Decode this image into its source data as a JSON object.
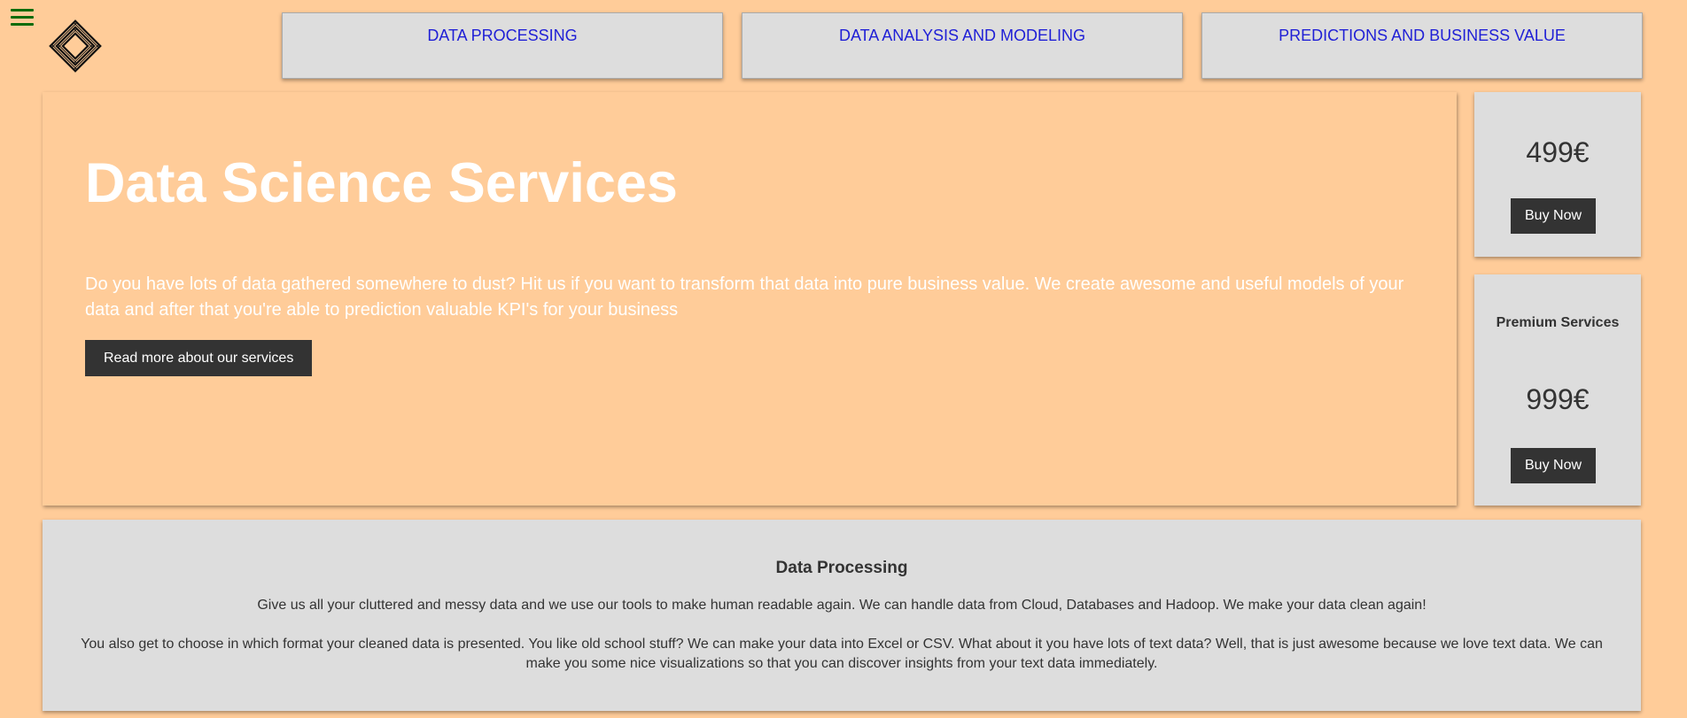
{
  "nav": {
    "tabs": [
      {
        "label": "DATA PROCESSING"
      },
      {
        "label": "DATA ANALYSIS AND MODELING"
      },
      {
        "label": "PREDICTIONS AND BUSINESS VALUE"
      }
    ]
  },
  "hero": {
    "title": "Data Science Services",
    "description": "Do you have lots of data gathered somewhere to dust? Hit us if you want to transform that data into pure business value. We create awesome and useful models of your data and after that you're able to prediction valuable KPI's for your business",
    "button_label": "Read more about our services"
  },
  "pricing": [
    {
      "label": "",
      "price": "499€",
      "button_label": "Buy Now"
    },
    {
      "label": "Premium Services",
      "price": "999€",
      "button_label": "Buy Now"
    }
  ],
  "info": {
    "heading": "Data Processing",
    "paragraphs": [
      "Give us all your cluttered and messy data and we use our tools to make human readable again. We can handle data from Cloud, Databases and Hadoop. We make your data clean again!",
      "You also get to choose in which format your cleaned data is presented. You like old school stuff? We can make your data into Excel or CSV. What about it you have lots of text data? Well, that is just awesome because we love text data. We can make you some nice visualizations so that you can discover insights from your text data immediately."
    ]
  },
  "colors": {
    "background": "#ffcc99",
    "panel": "#dddddd",
    "button": "#333333",
    "link": "#1f1fd6",
    "menu_icon": "#0a6b0a"
  },
  "icons": {
    "menu": "hamburger-menu-icon",
    "logo": "diamond-logo"
  }
}
